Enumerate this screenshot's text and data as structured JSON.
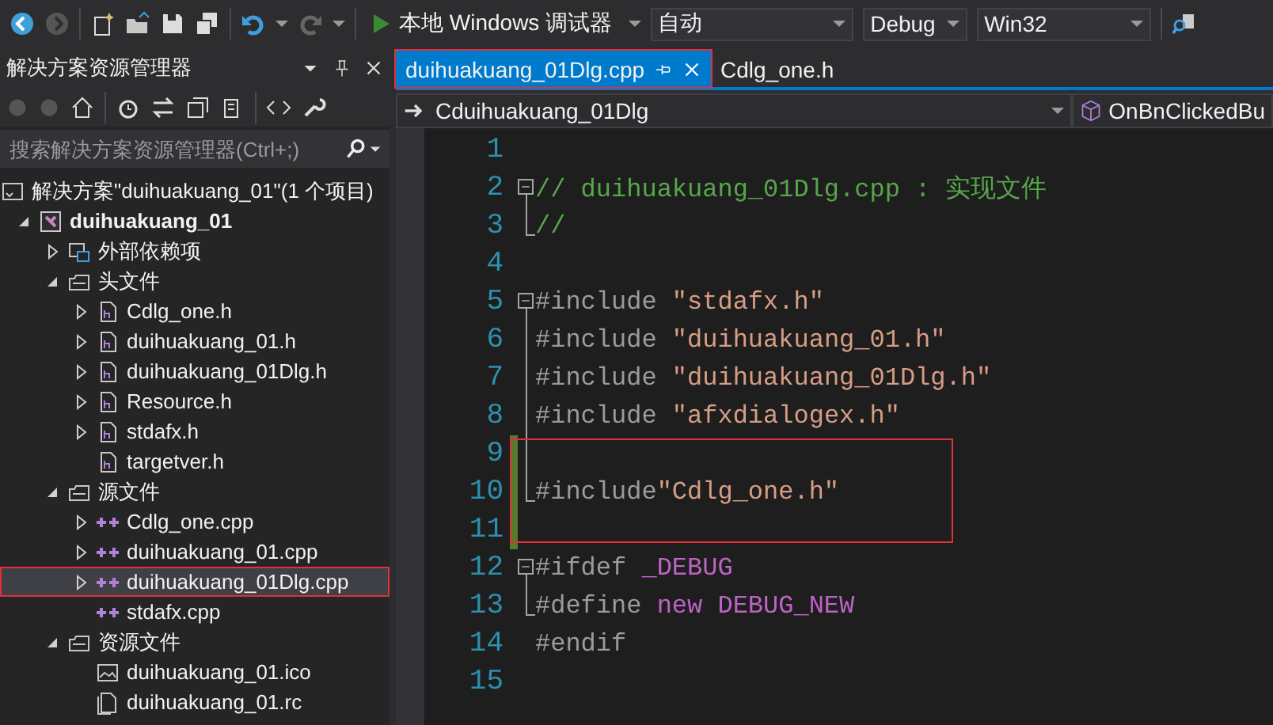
{
  "toolbar": {
    "run_button": "本地 Windows 调试器",
    "combos": [
      {
        "value": "自动"
      },
      {
        "value": "Debug"
      },
      {
        "value": "Win32"
      }
    ]
  },
  "solution_explorer": {
    "title": "解决方案资源管理器",
    "search": {
      "placeholder": "搜索解决方案资源管理器(Ctrl+;)"
    },
    "tree": [
      {
        "label": "解决方案\"duihuakuang_01\"(1 个项目)",
        "kind": "solution",
        "expandable": false,
        "selected": false,
        "highlighted": false,
        "children": [
          {
            "label": "duihuakuang_01",
            "kind": "project",
            "expandable": true,
            "expanded": true,
            "selected": false,
            "highlighted": false,
            "children": [
              {
                "label": "外部依赖项",
                "kind": "references",
                "expandable": true,
                "expanded": false,
                "selected": false,
                "highlighted": false
              },
              {
                "label": "头文件",
                "kind": "folder",
                "expandable": true,
                "expanded": true,
                "selected": false,
                "highlighted": false,
                "children": [
                  {
                    "label": "Cdlg_one.h",
                    "kind": "header",
                    "expandable": true,
                    "expanded": false,
                    "selected": false,
                    "highlighted": false
                  },
                  {
                    "label": "duihuakuang_01.h",
                    "kind": "header",
                    "expandable": true,
                    "expanded": false,
                    "selected": false,
                    "highlighted": false
                  },
                  {
                    "label": "duihuakuang_01Dlg.h",
                    "kind": "header",
                    "expandable": true,
                    "expanded": false,
                    "selected": false,
                    "highlighted": false
                  },
                  {
                    "label": "Resource.h",
                    "kind": "header",
                    "expandable": true,
                    "expanded": false,
                    "selected": false,
                    "highlighted": false
                  },
                  {
                    "label": "stdafx.h",
                    "kind": "header",
                    "expandable": true,
                    "expanded": false,
                    "selected": false,
                    "highlighted": false
                  },
                  {
                    "label": "targetver.h",
                    "kind": "header",
                    "expandable": false,
                    "selected": false,
                    "highlighted": false
                  }
                ]
              },
              {
                "label": "源文件",
                "kind": "folder",
                "expandable": true,
                "expanded": true,
                "selected": false,
                "highlighted": false,
                "children": [
                  {
                    "label": "Cdlg_one.cpp",
                    "kind": "source",
                    "expandable": true,
                    "expanded": false,
                    "selected": false,
                    "highlighted": false
                  },
                  {
                    "label": "duihuakuang_01.cpp",
                    "kind": "source",
                    "expandable": true,
                    "expanded": false,
                    "selected": false,
                    "highlighted": false
                  },
                  {
                    "label": "duihuakuang_01Dlg.cpp",
                    "kind": "source",
                    "expandable": true,
                    "expanded": false,
                    "selected": true,
                    "highlighted": true
                  },
                  {
                    "label": "stdafx.cpp",
                    "kind": "source",
                    "expandable": false,
                    "selected": false,
                    "highlighted": false
                  }
                ]
              },
              {
                "label": "资源文件",
                "kind": "folder",
                "expandable": true,
                "expanded": true,
                "selected": false,
                "highlighted": false,
                "children": [
                  {
                    "label": "duihuakuang_01.ico",
                    "kind": "image",
                    "expandable": false,
                    "selected": false,
                    "highlighted": false
                  },
                  {
                    "label": "duihuakuang_01.rc",
                    "kind": "resource",
                    "expandable": false,
                    "selected": false,
                    "highlighted": false
                  }
                ]
              }
            ]
          }
        ]
      }
    ]
  },
  "editor": {
    "tabs": [
      {
        "label": "duihuakuang_01Dlg.cpp",
        "selected": true,
        "highlighted": true
      },
      {
        "label": "Cdlg_one.h",
        "selected": false,
        "highlighted": false
      }
    ],
    "nav_bar": {
      "class": "Cduihuakuang_01Dlg",
      "member": "OnBnClickedBu"
    },
    "blocks": [
      {
        "boxed": false,
        "lines": [
          {
            "number": "1",
            "kind": "plain",
            "changed": false
          },
          {
            "number": "2",
            "kind": "start",
            "changed": false,
            "tokens": [
              {
                "kind": "comment",
                "text": "// duihuakuang_01Dlg.cpp : 实现文件"
              }
            ]
          },
          {
            "number": "3",
            "kind": "end",
            "changed": false,
            "tokens": [
              {
                "kind": "comment",
                "text": "//"
              }
            ]
          },
          {
            "number": "4",
            "kind": "plain",
            "changed": false
          },
          {
            "number": "5",
            "kind": "start",
            "changed": false,
            "tokens": [
              {
                "kind": "directive",
                "text": "#include "
              },
              {
                "kind": "string",
                "text": "\"stdafx.h\""
              }
            ]
          },
          {
            "number": "6",
            "kind": "inside",
            "changed": false,
            "tokens": [
              {
                "kind": "directive",
                "text": "#include "
              },
              {
                "kind": "string",
                "text": "\"duihuakuang_01.h\""
              }
            ]
          },
          {
            "number": "7",
            "kind": "inside",
            "changed": false,
            "tokens": [
              {
                "kind": "directive",
                "text": "#include "
              },
              {
                "kind": "string",
                "text": "\"duihuakuang_01Dlg.h\""
              }
            ]
          },
          {
            "number": "8",
            "kind": "inside",
            "changed": false,
            "tokens": [
              {
                "kind": "directive",
                "text": "#include "
              },
              {
                "kind": "string",
                "text": "\"afxdialogex.h\""
              }
            ]
          }
        ]
      },
      {
        "boxed": true,
        "lines": [
          {
            "number": "9",
            "kind": "inside",
            "changed": true
          },
          {
            "number": "10",
            "kind": "end",
            "changed": true,
            "tokens": [
              {
                "kind": "directive",
                "text": "#include"
              },
              {
                "kind": "string",
                "text": "\"Cdlg_one.h\""
              }
            ]
          },
          {
            "number": "11",
            "kind": "plain",
            "changed": true
          }
        ]
      },
      {
        "boxed": false,
        "lines": [
          {
            "number": "12",
            "kind": "start",
            "changed": false,
            "tokens": [
              {
                "kind": "directive",
                "text": "#ifdef "
              },
              {
                "kind": "macro",
                "text": "_DEBUG"
              }
            ]
          },
          {
            "number": "13",
            "kind": "end",
            "changed": false,
            "tokens": [
              {
                "kind": "directive",
                "text": "#define "
              },
              {
                "kind": "macro",
                "text": "new DEBUG_NEW"
              }
            ]
          },
          {
            "number": "14",
            "kind": "plain",
            "changed": false,
            "tokens": [
              {
                "kind": "directive",
                "text": "#endif"
              }
            ]
          },
          {
            "number": "15",
            "kind": "plain",
            "changed": false
          }
        ]
      }
    ]
  }
}
